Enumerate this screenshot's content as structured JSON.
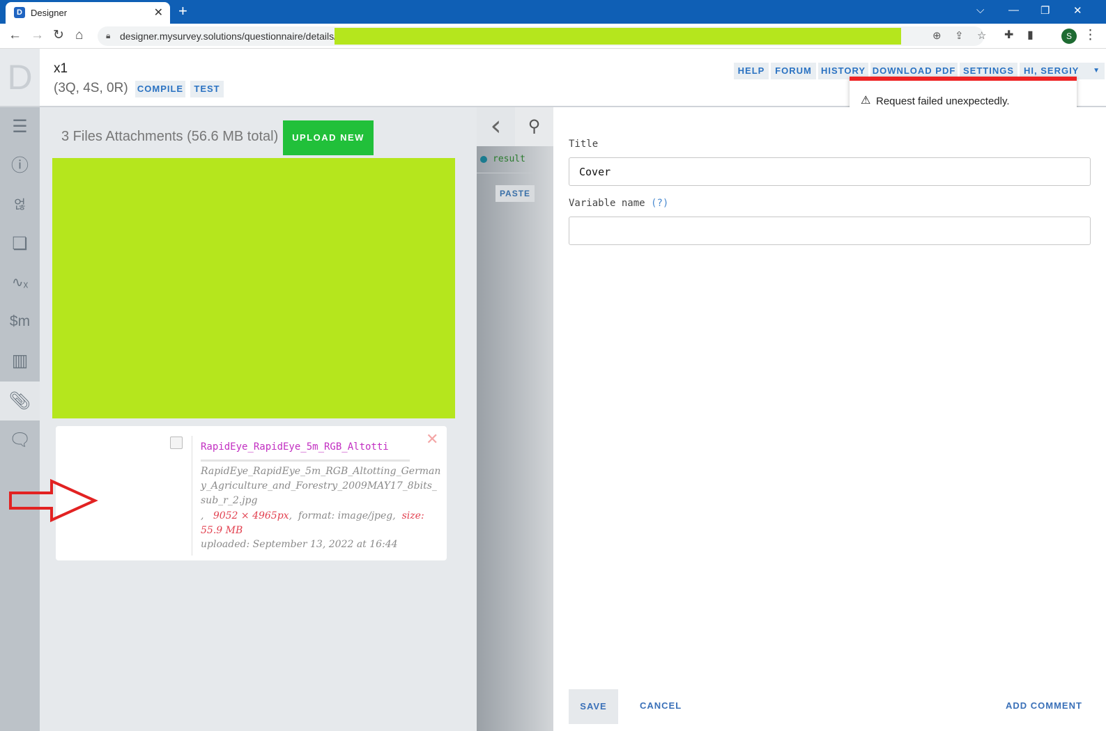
{
  "browser": {
    "tab_title": "Designer",
    "tab_favicon": "D",
    "tab_close": "✕",
    "new_tab": "+",
    "url": "designer.mysurvey.solutions/questionnaire/details/",
    "profile_initial": "S"
  },
  "header": {
    "title": "x1",
    "stats": "(3Q, 4S, 0R)",
    "compile_label": "COMPILE",
    "test_label": "TEST",
    "nav": {
      "help": "HELP",
      "forum": "FORUM",
      "history": "HISTORY",
      "download_pdf": "DOWNLOAD PDF",
      "settings": "SETTINGS",
      "user": "HI, SERGIY"
    }
  },
  "toast": {
    "message": "Request failed unexpectedly."
  },
  "attachments": {
    "heading": "3 Files Attachments (56.6 MB total)",
    "upload_label": "UPLOAD NEW",
    "file": {
      "short_name": "RapidEye_RapidEye_5m_RGB_Altotti",
      "full_name": "RapidEye_RapidEye_5m_RGB_Altotting_Germany_Agriculture_and_Forestry_2009MAY17_8bits_sub_r_2.jpg",
      "meta_prefix": ",",
      "dimensions": "9052 × 4965px",
      "format": "format: image/jpeg",
      "size_label": "size:",
      "size_value": "55.9 MB",
      "uploaded": "uploaded: September 13, 2022 at 16:44",
      "delete_glyph": "✕"
    }
  },
  "tree": {
    "item_label": "result",
    "paste_label": "PASTE"
  },
  "editor": {
    "title_label": "Title",
    "title_value": "Cover",
    "variable_label": "Variable name",
    "variable_help": "(?)",
    "variable_value": "",
    "save_label": "SAVE",
    "cancel_label": "CANCEL",
    "add_comment_label": "ADD COMMENT"
  },
  "colors": {
    "accent_blue": "#2a72c2",
    "upload_green": "#21c03a",
    "redaction": "#b5e61d",
    "error_red": "#ee2324",
    "browser_blue": "#0f5fb5"
  }
}
